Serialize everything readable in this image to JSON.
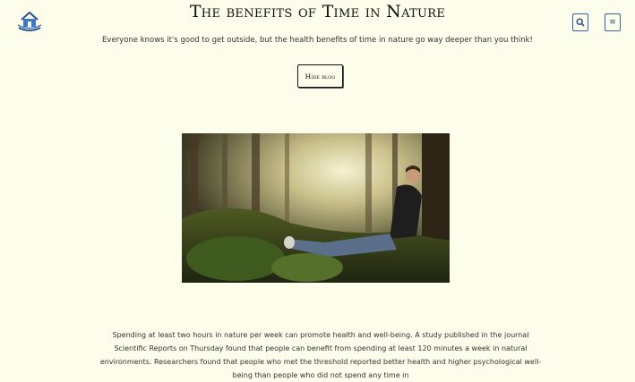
{
  "header": {
    "title": "The benefits of Time in Nature",
    "subtitle": "Everyone knows it's good to get outside, but the health benefits of time in nature go way deeper than you think!",
    "logo_icon": "home-logo-icon",
    "search_icon": "search-icon",
    "menu_icon": "menu-icon",
    "menu_glyph": "≡"
  },
  "actions": {
    "hide_blog_label": "Hide blog"
  },
  "hero": {
    "image_icon": "forest-hiker-photo"
  },
  "article": {
    "body": "Spending at least two hours in nature per week can promote health and well-being. A study published in the journal Scientific Reports on Thursday found that people can benefit from spending at least 120 minutes a week in natural environments. Researchers found that people who met the threshold reported better health and higher psychological well-being than people who did not spend any time in"
  },
  "colors": {
    "background": "#fdfdec",
    "accent": "#2c4f8f"
  }
}
